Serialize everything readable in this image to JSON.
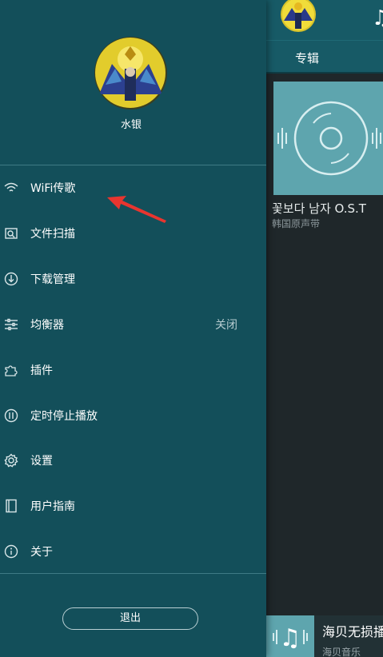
{
  "drawer": {
    "user_name": "水银",
    "menu": [
      {
        "label": "WiFi传歌",
        "icon": "wifi-icon"
      },
      {
        "label": "文件扫描",
        "icon": "scan-icon"
      },
      {
        "label": "下载管理",
        "icon": "download-icon"
      },
      {
        "label": "均衡器",
        "icon": "equalizer-icon",
        "value": "关闭"
      },
      {
        "label": "插件",
        "icon": "puzzle-icon"
      },
      {
        "label": "定时停止播放",
        "icon": "timer-icon"
      },
      {
        "label": "设置",
        "icon": "gear-icon"
      },
      {
        "label": "用户指南",
        "icon": "book-icon"
      },
      {
        "label": "关于",
        "icon": "info-icon"
      }
    ],
    "logout_label": "退出"
  },
  "main": {
    "header_icon": "music-note-icon",
    "tab_label": "专辑",
    "album": {
      "title": "꽃보다 남자 O.S.T",
      "subtitle": "韩国原声带"
    },
    "player": {
      "title": "海贝无损播",
      "subtitle": "海贝音乐"
    }
  },
  "annotation": {
    "icon": "red-arrow",
    "color": "#e8352f"
  },
  "colors": {
    "drawer_bg": "#134f5a",
    "header_bg": "#175a66",
    "content_bg": "#1f272a",
    "cover_bg": "#5ea5ae"
  }
}
